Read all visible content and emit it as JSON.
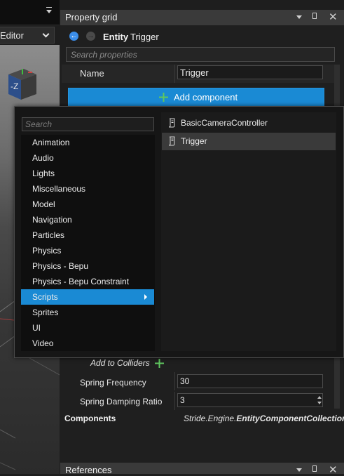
{
  "viewport": {
    "toolbar_dropdown": "▾",
    "editor_selector": "Editor",
    "gizmo_axis_label": "-Z"
  },
  "property_grid": {
    "title": "Property grid",
    "entity_kind": "Entity",
    "entity_name": "Trigger",
    "search_placeholder": "Search properties",
    "name_label": "Name",
    "name_value": "Trigger",
    "add_component_label": "Add component",
    "add_to_colliders_label": "Add to Colliders",
    "spring_frequency_label": "Spring Frequency",
    "spring_frequency_value": "30",
    "spring_damping_label": "Spring Damping Ratio",
    "spring_damping_value": "3",
    "components_label": "Components",
    "components_type_prefix": "Stride.Engine.",
    "components_type_name": "EntityComponentCollection"
  },
  "references": {
    "title": "References"
  },
  "add_component_popup": {
    "search_placeholder": "Search",
    "categories": [
      "Animation",
      "Audio",
      "Lights",
      "Miscellaneous",
      "Model",
      "Navigation",
      "Particles",
      "Physics",
      "Physics - Bepu",
      "Physics - Bepu Constraint",
      "Scripts",
      "Sprites",
      "UI",
      "Video"
    ],
    "selected_category": "Scripts",
    "components": [
      "BasicCameraController",
      "Trigger"
    ],
    "selected_component": "Trigger"
  },
  "colors": {
    "accent": "#1a8ad4",
    "panel_background": "#1f1f1f",
    "title_bar": "#3a3a3a",
    "add_icon_green": "#5fc75f"
  }
}
